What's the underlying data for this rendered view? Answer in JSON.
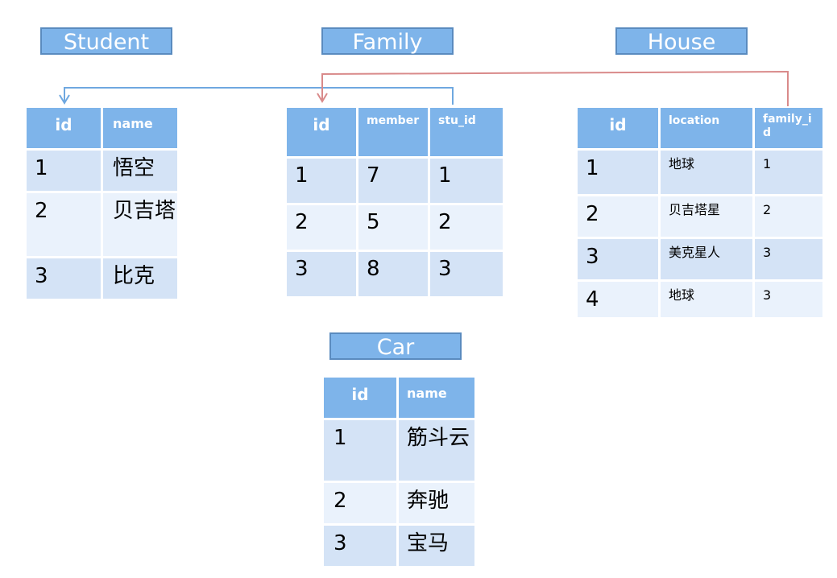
{
  "titles": {
    "student": "Student",
    "family": "Family",
    "house": "House",
    "car": "Car"
  },
  "student": {
    "headers": [
      "id",
      "name"
    ],
    "rows": [
      [
        "1",
        "悟空"
      ],
      [
        "2",
        "贝吉塔"
      ],
      [
        "3",
        "比克"
      ]
    ]
  },
  "family": {
    "headers": [
      "id",
      "member",
      "stu_id"
    ],
    "rows": [
      [
        "1",
        "7",
        "1"
      ],
      [
        "2",
        "5",
        "2"
      ],
      [
        "3",
        "8",
        "3"
      ]
    ]
  },
  "house": {
    "headers": [
      "id",
      "location",
      "family_id"
    ],
    "rows": [
      [
        "1",
        "地球",
        "1"
      ],
      [
        "2",
        "贝吉塔星",
        "2"
      ],
      [
        "3",
        "美克星人",
        "3"
      ],
      [
        "4",
        "地球",
        "3"
      ]
    ]
  },
  "car": {
    "headers": [
      "id",
      "name"
    ],
    "rows": [
      [
        "1",
        "筋斗云"
      ],
      [
        "2",
        "奔驰"
      ],
      [
        "3",
        "宝马"
      ]
    ]
  },
  "colors": {
    "header": "#7eb4ea",
    "row_odd": "#d4e3f6",
    "row_even": "#eaf2fc",
    "link_student": "#6fa8e0",
    "link_family": "#d98a8a"
  }
}
